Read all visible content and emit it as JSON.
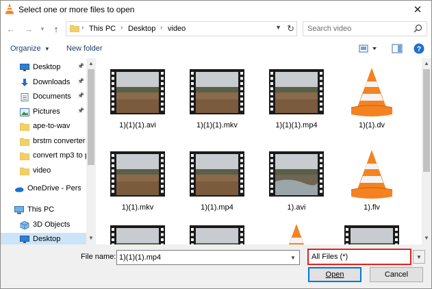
{
  "window": {
    "title": "Select one or more files to open"
  },
  "address": {
    "crumbs": [
      "This PC",
      "Desktop",
      "video"
    ]
  },
  "search": {
    "placeholder": "Search video"
  },
  "toolbar": {
    "organize_label": "Organize",
    "new_folder_label": "New folder"
  },
  "nav": {
    "items": [
      {
        "label": "Desktop",
        "icon": "desktop-icon",
        "pinned": true
      },
      {
        "label": "Downloads",
        "icon": "download-icon",
        "pinned": true
      },
      {
        "label": "Documents",
        "icon": "documents-icon",
        "pinned": true
      },
      {
        "label": "Pictures",
        "icon": "pictures-icon",
        "pinned": true
      },
      {
        "label": "ape-to-wav",
        "icon": "folder-icon"
      },
      {
        "label": "brstm converter",
        "icon": "folder-icon"
      },
      {
        "label": "convert mp3 to p",
        "icon": "folder-icon"
      },
      {
        "label": "video",
        "icon": "folder-icon"
      },
      {
        "label": "OneDrive - Persor",
        "icon": "onedrive-icon"
      },
      {
        "label": "This PC",
        "icon": "computer-icon"
      },
      {
        "label": "3D Objects",
        "icon": "3d-objects-icon"
      },
      {
        "label": "Desktop",
        "icon": "desktop-icon",
        "selected": true
      }
    ]
  },
  "files": [
    {
      "name": "1)(1)(1).avi",
      "type": "video"
    },
    {
      "name": "1)(1)(1).mkv",
      "type": "video"
    },
    {
      "name": "1)(1)(1).mp4",
      "type": "video"
    },
    {
      "name": "1)(1).dv",
      "type": "vlc"
    },
    {
      "name": "1)(1).mkv",
      "type": "video"
    },
    {
      "name": "1)(1).mp4",
      "type": "video"
    },
    {
      "name": "1).avi",
      "type": "video-water"
    },
    {
      "name": "1).flv",
      "type": "vlc"
    },
    {
      "name": "",
      "type": "video"
    },
    {
      "name": "",
      "type": "video"
    },
    {
      "name": "",
      "type": "vlc"
    },
    {
      "name": "",
      "type": "video"
    }
  ],
  "bottom": {
    "file_name_label": "File name:",
    "file_name_value": "1)(1)(1).mp4",
    "filter_value": "All Files  (*)",
    "open_label": "Open",
    "cancel_label": "Cancel"
  },
  "colors": {
    "accent": "#0078d7",
    "highlight": "#e02020",
    "selected": "#cce4f7"
  }
}
